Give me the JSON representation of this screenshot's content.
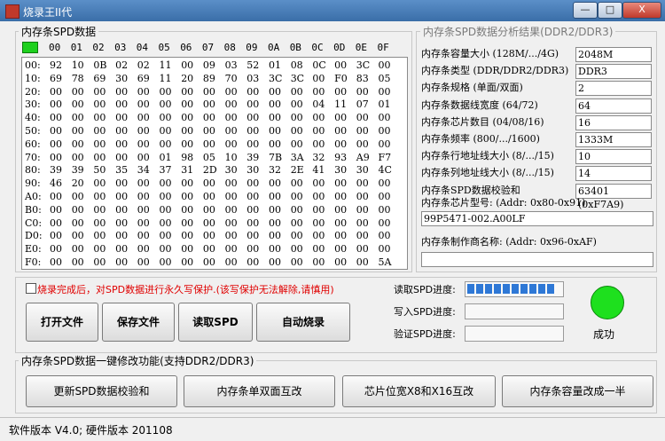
{
  "window": {
    "title": "烧录王II代",
    "minimize": "—",
    "maximize": "□",
    "close": "X"
  },
  "hex": {
    "legend": "内存条SPD数据",
    "columns": [
      "00",
      "01",
      "02",
      "03",
      "04",
      "05",
      "06",
      "07",
      "08",
      "09",
      "0A",
      "0B",
      "0C",
      "0D",
      "0E",
      "0F"
    ],
    "rows": [
      {
        "addr": "00:",
        "cells": [
          "92",
          "10",
          "0B",
          "02",
          "02",
          "11",
          "00",
          "09",
          "03",
          "52",
          "01",
          "08",
          "0C",
          "00",
          "3C",
          "00"
        ]
      },
      {
        "addr": "10:",
        "cells": [
          "69",
          "78",
          "69",
          "30",
          "69",
          "11",
          "20",
          "89",
          "70",
          "03",
          "3C",
          "3C",
          "00",
          "F0",
          "83",
          "05"
        ]
      },
      {
        "addr": "20:",
        "cells": [
          "00",
          "00",
          "00",
          "00",
          "00",
          "00",
          "00",
          "00",
          "00",
          "00",
          "00",
          "00",
          "00",
          "00",
          "00",
          "00"
        ]
      },
      {
        "addr": "30:",
        "cells": [
          "00",
          "00",
          "00",
          "00",
          "00",
          "00",
          "00",
          "00",
          "00",
          "00",
          "00",
          "00",
          "04",
          "11",
          "07",
          "01"
        ]
      },
      {
        "addr": "40:",
        "cells": [
          "00",
          "00",
          "00",
          "00",
          "00",
          "00",
          "00",
          "00",
          "00",
          "00",
          "00",
          "00",
          "00",
          "00",
          "00",
          "00"
        ]
      },
      {
        "addr": "50:",
        "cells": [
          "00",
          "00",
          "00",
          "00",
          "00",
          "00",
          "00",
          "00",
          "00",
          "00",
          "00",
          "00",
          "00",
          "00",
          "00",
          "00"
        ]
      },
      {
        "addr": "60:",
        "cells": [
          "00",
          "00",
          "00",
          "00",
          "00",
          "00",
          "00",
          "00",
          "00",
          "00",
          "00",
          "00",
          "00",
          "00",
          "00",
          "00"
        ]
      },
      {
        "addr": "70:",
        "cells": [
          "00",
          "00",
          "00",
          "00",
          "00",
          "01",
          "98",
          "05",
          "10",
          "39",
          "7B",
          "3A",
          "32",
          "93",
          "A9",
          "F7"
        ]
      },
      {
        "addr": "80:",
        "cells": [
          "39",
          "39",
          "50",
          "35",
          "34",
          "37",
          "31",
          "2D",
          "30",
          "30",
          "32",
          "2E",
          "41",
          "30",
          "30",
          "4C"
        ]
      },
      {
        "addr": "90:",
        "cells": [
          "46",
          "20",
          "00",
          "00",
          "00",
          "00",
          "00",
          "00",
          "00",
          "00",
          "00",
          "00",
          "00",
          "00",
          "00",
          "00"
        ]
      },
      {
        "addr": "A0:",
        "cells": [
          "00",
          "00",
          "00",
          "00",
          "00",
          "00",
          "00",
          "00",
          "00",
          "00",
          "00",
          "00",
          "00",
          "00",
          "00",
          "00"
        ]
      },
      {
        "addr": "B0:",
        "cells": [
          "00",
          "00",
          "00",
          "00",
          "00",
          "00",
          "00",
          "00",
          "00",
          "00",
          "00",
          "00",
          "00",
          "00",
          "00",
          "00"
        ]
      },
      {
        "addr": "C0:",
        "cells": [
          "00",
          "00",
          "00",
          "00",
          "00",
          "00",
          "00",
          "00",
          "00",
          "00",
          "00",
          "00",
          "00",
          "00",
          "00",
          "00"
        ]
      },
      {
        "addr": "D0:",
        "cells": [
          "00",
          "00",
          "00",
          "00",
          "00",
          "00",
          "00",
          "00",
          "00",
          "00",
          "00",
          "00",
          "00",
          "00",
          "00",
          "00"
        ]
      },
      {
        "addr": "E0:",
        "cells": [
          "00",
          "00",
          "00",
          "00",
          "00",
          "00",
          "00",
          "00",
          "00",
          "00",
          "00",
          "00",
          "00",
          "00",
          "00",
          "00"
        ]
      },
      {
        "addr": "F0:",
        "cells": [
          "00",
          "00",
          "00",
          "00",
          "00",
          "00",
          "00",
          "00",
          "00",
          "00",
          "00",
          "00",
          "00",
          "00",
          "00",
          "5A"
        ]
      }
    ]
  },
  "analysis": {
    "legend": "内存条SPD数据分析结果(DDR2/DDR3)",
    "items": [
      {
        "label": "内存条容量大小 (128M/.../4G)",
        "value": "2048M"
      },
      {
        "label": "内存条类型 (DDR/DDR2/DDR3)",
        "value": "DDR3"
      },
      {
        "label": "内存条规格 (单面/双面)",
        "value": "2"
      },
      {
        "label": "内存条数据线宽度 (64/72)",
        "value": "64"
      },
      {
        "label": "内存条芯片数目 (04/08/16)",
        "value": "16"
      },
      {
        "label": "内存条频率 (800/.../1600)",
        "value": "1333M"
      },
      {
        "label": "内存条行地址线大小 (8/.../15)",
        "value": "10"
      },
      {
        "label": "内存条列地址线大小 (8/.../15)",
        "value": "14"
      },
      {
        "label": "内存条SPD数据校验和",
        "value": "63401 (0xF7A9)"
      }
    ],
    "chip_model_label": "内存条芯片型号: (Addr: 0x80-0x91)",
    "chip_model_value": "99P5471-002.A00LF",
    "manufacturer_label": "内存条制作商名称: (Addr: 0x96-0xAF)",
    "manufacturer_value": ""
  },
  "controls": {
    "write_protect_label": "烧录完成后，对SPD数据进行永久写保护.(该写保护无法解除,请慎用)",
    "open_file": "打开文件",
    "save_file": "保存文件",
    "read_spd": "读取SPD",
    "auto_burn": "自动烧录",
    "read_progress_label": "读取SPD进度:",
    "write_progress_label": "写入SPD进度:",
    "verify_progress_label": "验证SPD进度:",
    "read_progress": 1.0,
    "write_progress": 0,
    "verify_progress": 0,
    "status_text": "成功",
    "status_color": "#1ee01e"
  },
  "oneclick": {
    "legend": "内存条SPD数据一键修改功能(支持DDR2/DDR3)",
    "btn_checksum": "更新SPD数据校验和",
    "btn_side": "内存条单双面互改",
    "btn_width": "芯片位宽X8和X16互改",
    "btn_capacity": "内存条容量改成一半"
  },
  "statusbar": {
    "text": "软件版本 V4.0; 硬件版本 201108"
  }
}
